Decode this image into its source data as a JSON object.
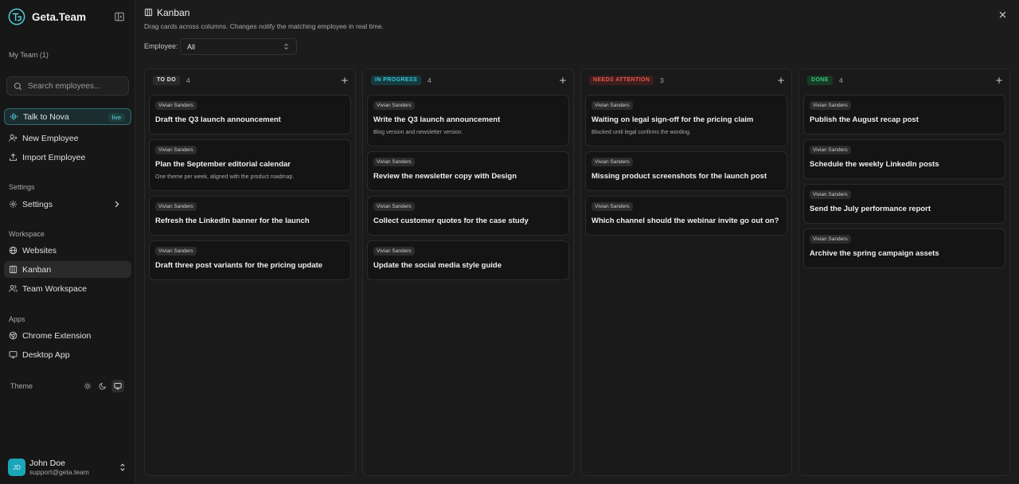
{
  "app": {
    "name": "Geta.Team"
  },
  "sidebar": {
    "team_label": "My Team (1)",
    "search_placeholder": "Search employees...",
    "talk": {
      "label": "Talk to Nova",
      "badge": "live"
    },
    "actions": [
      {
        "label": "New Employee",
        "icon": "user-plus-icon"
      },
      {
        "label": "Import Employee",
        "icon": "upload-icon"
      }
    ],
    "settings_section": "Settings",
    "settings_item": {
      "label": "Settings",
      "icon": "gear-icon"
    },
    "workspace_section": "Workspace",
    "workspace_items": [
      {
        "label": "Websites",
        "icon": "globe-icon"
      },
      {
        "label": "Kanban",
        "icon": "kanban-icon",
        "active": true
      },
      {
        "label": "Team Workspace",
        "icon": "users-icon"
      }
    ],
    "apps_section": "Apps",
    "apps_items": [
      {
        "label": "Chrome Extension",
        "icon": "chrome-icon"
      },
      {
        "label": "Desktop App",
        "icon": "monitor-icon"
      }
    ],
    "theme_label": "Theme",
    "theme_options": [
      "light",
      "dark",
      "system"
    ],
    "theme_selected": "system",
    "user": {
      "initials": "JD",
      "name": "John Doe",
      "email": "support@geta.team"
    }
  },
  "page": {
    "title": "Kanban",
    "subtitle": "Drag cards across columns. Changes notify the matching employee in real time.",
    "filter_label": "Employee:",
    "filter_value": "All"
  },
  "colors": {
    "todo": "#e8e8e8",
    "in_progress": "#39c4d4",
    "needs_attention": "#e8574f",
    "done": "#39c47a"
  },
  "columns": [
    {
      "label": "TO DO",
      "count": "4",
      "style": "todo",
      "cards": [
        {
          "assignee": "Vivian Sanders",
          "title": "Draft the Q3 launch announcement",
          "desc": ""
        },
        {
          "assignee": "Vivian Sanders",
          "title": "Plan the September editorial calendar",
          "desc": "One theme per week, aligned with the product roadmap."
        },
        {
          "assignee": "Vivian Sanders",
          "title": "Refresh the LinkedIn banner for the launch",
          "desc": ""
        },
        {
          "assignee": "Vivian Sanders",
          "title": "Draft three post variants for the pricing update",
          "desc": ""
        }
      ]
    },
    {
      "label": "IN PROGRESS",
      "count": "4",
      "style": "in_progress",
      "cards": [
        {
          "assignee": "Vivian Sanders",
          "title": "Write the Q3 launch announcement",
          "desc": "Blog version and newsletter version."
        },
        {
          "assignee": "Vivian Sanders",
          "title": "Review the newsletter copy with Design",
          "desc": ""
        },
        {
          "assignee": "Vivian Sanders",
          "title": "Collect customer quotes for the case study",
          "desc": ""
        },
        {
          "assignee": "Vivian Sanders",
          "title": "Update the social media style guide",
          "desc": ""
        }
      ]
    },
    {
      "label": "NEEDS ATTENTION",
      "count": "3",
      "style": "needs_attention",
      "cards": [
        {
          "assignee": "Vivian Sanders",
          "title": "Waiting on legal sign-off for the pricing claim",
          "desc": "Blocked until legal confirms the wording."
        },
        {
          "assignee": "Vivian Sanders",
          "title": "Missing product screenshots for the launch post",
          "desc": ""
        },
        {
          "assignee": "Vivian Sanders",
          "title": "Which channel should the webinar invite go out on?",
          "desc": ""
        }
      ]
    },
    {
      "label": "DONE",
      "count": "4",
      "style": "done",
      "cards": [
        {
          "assignee": "Vivian Sanders",
          "title": "Publish the August recap post",
          "desc": ""
        },
        {
          "assignee": "Vivian Sanders",
          "title": "Schedule the weekly LinkedIn posts",
          "desc": ""
        },
        {
          "assignee": "Vivian Sanders",
          "title": "Send the July performance report",
          "desc": ""
        },
        {
          "assignee": "Vivian Sanders",
          "title": "Archive the spring campaign assets",
          "desc": ""
        }
      ]
    }
  ]
}
